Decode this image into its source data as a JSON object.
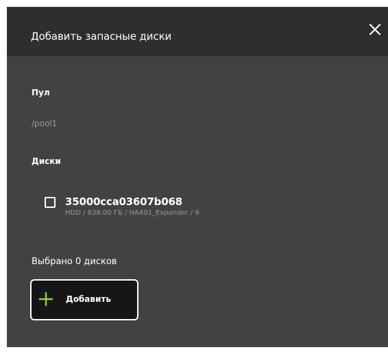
{
  "dialog": {
    "title": "Добавить запасные диски",
    "close_icon": "close-icon"
  },
  "pool": {
    "label": "Пул",
    "value": "/pool1"
  },
  "disks": {
    "label": "Диски",
    "items": [
      {
        "name": "35000cca03607b068",
        "details": "HDD / 838.00 ГБ / HA401_Expander / 9",
        "checked": false
      }
    ]
  },
  "selection": {
    "count_text": "Выбрано 0 дисков"
  },
  "add_button": {
    "label": "Добавить",
    "icon": "plus-icon"
  },
  "colors": {
    "dialog_bg": "#424244",
    "header_bg": "#2e2e31",
    "muted_text": "#9a9a9c",
    "accent_plus": "#8fd93a",
    "button_bg": "#161616"
  }
}
